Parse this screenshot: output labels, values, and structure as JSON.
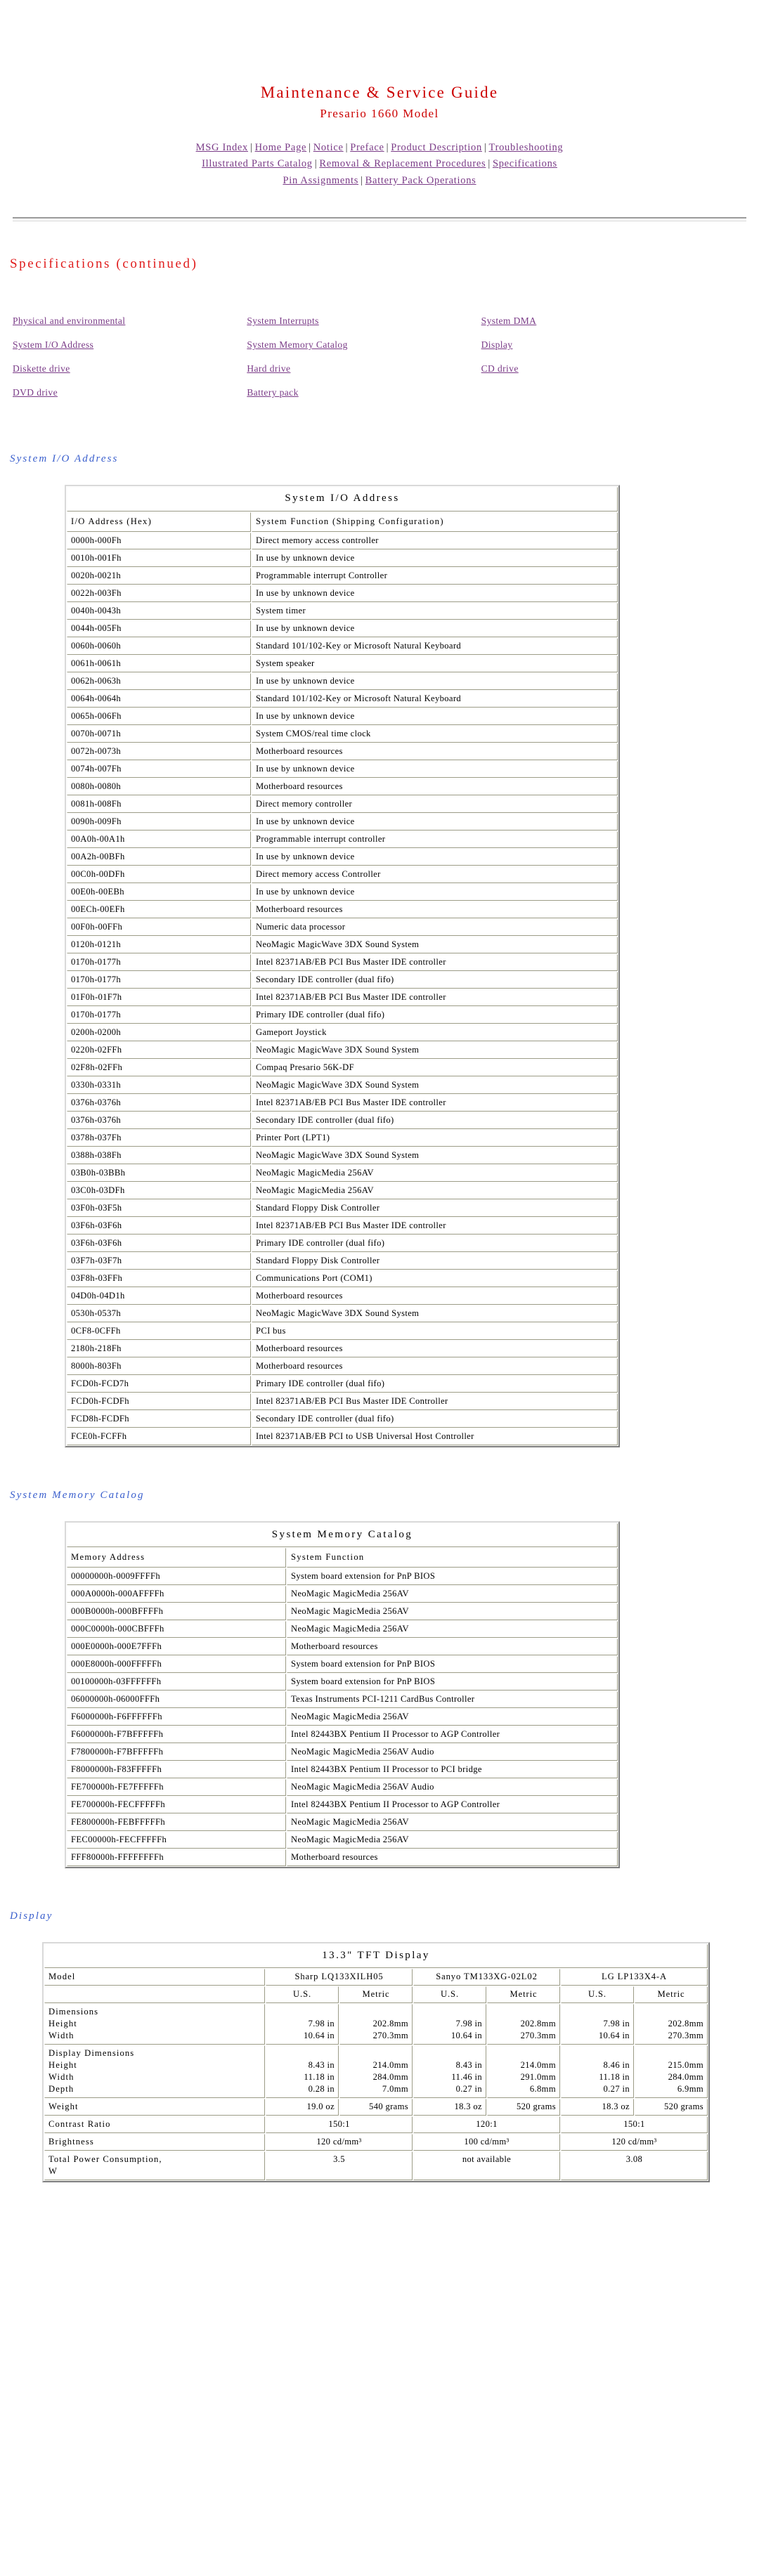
{
  "header": {
    "title": "Maintenance & Service Guide",
    "subtitle": "Presario 1660 Model",
    "nav_line1": [
      "MSG Index",
      "Home Page",
      "Notice",
      "Preface",
      "Product Description",
      "Troubleshooting"
    ],
    "nav_line2": [
      "Illustrated Parts Catalog",
      "Removal & Replacement Procedures",
      "Specifications"
    ],
    "nav_line3": [
      "Pin Assignments",
      "Battery Pack Operations"
    ],
    "separator": "|"
  },
  "page_heading": "Specifications (continued)",
  "link_grid": [
    [
      "Physical and environmental",
      "System Interrupts",
      "System DMA"
    ],
    [
      "System I/O Address",
      "System Memory Catalog",
      "Display"
    ],
    [
      "Diskette drive",
      "Hard drive",
      "CD drive"
    ],
    [
      "DVD drive",
      "Battery pack",
      ""
    ]
  ],
  "io_section": {
    "subhead": "System I/O Address",
    "caption": "System I/O Address",
    "columns": [
      "I/O Address (Hex)",
      "System Function (Shipping Configuration)"
    ],
    "rows": [
      [
        "0000h-000Fh",
        "Direct memory access controller"
      ],
      [
        "0010h-001Fh",
        "In use by unknown device"
      ],
      [
        "0020h-0021h",
        "Programmable interrupt Controller"
      ],
      [
        "0022h-003Fh",
        "In use by unknown device"
      ],
      [
        "0040h-0043h",
        "System timer"
      ],
      [
        "0044h-005Fh",
        "In use by unknown device"
      ],
      [
        "0060h-0060h",
        "Standard 101/102-Key or Microsoft Natural Keyboard"
      ],
      [
        "0061h-0061h",
        "System speaker"
      ],
      [
        "0062h-0063h",
        "In use by unknown device"
      ],
      [
        "0064h-0064h",
        "Standard 101/102-Key or Microsoft Natural Keyboard"
      ],
      [
        "0065h-006Fh",
        "In use by unknown device"
      ],
      [
        "0070h-0071h",
        "System CMOS/real time clock"
      ],
      [
        "0072h-0073h",
        "Motherboard resources"
      ],
      [
        "0074h-007Fh",
        "In use by unknown device"
      ],
      [
        "0080h-0080h",
        "Motherboard resources"
      ],
      [
        "0081h-008Fh",
        "Direct memory controller"
      ],
      [
        "0090h-009Fh",
        "In use by unknown device"
      ],
      [
        "00A0h-00A1h",
        "Programmable interrupt controller"
      ],
      [
        "00A2h-00BFh",
        "In use by unknown device"
      ],
      [
        "00C0h-00DFh",
        "Direct memory access Controller"
      ],
      [
        "00E0h-00EBh",
        "In use by unknown device"
      ],
      [
        "00ECh-00EFh",
        "Motherboard resources"
      ],
      [
        "00F0h-00FFh",
        "Numeric data processor"
      ],
      [
        "0120h-0121h",
        "NeoMagic MagicWave 3DX Sound System"
      ],
      [
        "0170h-0177h",
        "Intel 82371AB/EB PCI Bus Master IDE controller"
      ],
      [
        "0170h-0177h",
        "Secondary IDE controller (dual fifo)"
      ],
      [
        "01F0h-01F7h",
        "Intel 82371AB/EB PCI Bus Master IDE controller"
      ],
      [
        "0170h-0177h",
        "Primary IDE controller (dual fifo)"
      ],
      [
        "0200h-0200h",
        "Gameport Joystick"
      ],
      [
        "0220h-02FFh",
        "NeoMagic MagicWave 3DX Sound System"
      ],
      [
        "02F8h-02FFh",
        "Compaq Presario 56K-DF"
      ],
      [
        "0330h-0331h",
        "NeoMagic MagicWave 3DX Sound System"
      ],
      [
        "0376h-0376h",
        "Intel 82371AB/EB PCI Bus Master IDE controller"
      ],
      [
        "0376h-0376h",
        "Secondary IDE controller (dual fifo)"
      ],
      [
        "0378h-037Fh",
        "Printer Port (LPT1)"
      ],
      [
        "0388h-038Fh",
        "NeoMagic MagicWave 3DX Sound System"
      ],
      [
        "03B0h-03BBh",
        "NeoMagic MagicMedia 256AV"
      ],
      [
        "03C0h-03DFh",
        "NeoMagic MagicMedia 256AV"
      ],
      [
        "03F0h-03F5h",
        "Standard Floppy Disk Controller"
      ],
      [
        "03F6h-03F6h",
        "Intel 82371AB/EB PCI Bus Master IDE controller"
      ],
      [
        "03F6h-03F6h",
        "Primary IDE controller (dual fifo)"
      ],
      [
        "03F7h-03F7h",
        "Standard Floppy Disk Controller"
      ],
      [
        "03F8h-03FFh",
        "Communications Port (COM1)"
      ],
      [
        "04D0h-04D1h",
        "Motherboard resources"
      ],
      [
        "0530h-0537h",
        "NeoMagic MagicWave 3DX Sound System"
      ],
      [
        "0CF8-0CFFh",
        "PCI bus"
      ],
      [
        "2180h-218Fh",
        "Motherboard resources"
      ],
      [
        "8000h-803Fh",
        "Motherboard resources"
      ],
      [
        "FCD0h-FCD7h",
        "Primary IDE controller (dual fifo)"
      ],
      [
        "FCD0h-FCDFh",
        "Intel 82371AB/EB PCI Bus Master IDE Controller"
      ],
      [
        "FCD8h-FCDFh",
        "Secondary IDE controller (dual fifo)"
      ],
      [
        "FCE0h-FCFFh",
        "Intel 82371AB/EB PCI to USB Universal Host Controller"
      ]
    ]
  },
  "memory_section": {
    "subhead": "System Memory Catalog",
    "caption": "System Memory Catalog",
    "columns": [
      "Memory Address",
      "System Function"
    ],
    "rows": [
      [
        "00000000h-0009FFFFh",
        "System board extension for PnP BIOS"
      ],
      [
        "000A0000h-000AFFFFh",
        "NeoMagic MagicMedia 256AV"
      ],
      [
        "000B0000h-000BFFFFh",
        "NeoMagic MagicMedia 256AV"
      ],
      [
        "000C0000h-000CBFFFh",
        "NeoMagic MagicMedia 256AV"
      ],
      [
        "000E0000h-000E7FFFh",
        "Motherboard resources"
      ],
      [
        "000E8000h-000FFFFFh",
        "System board extension for PnP BIOS"
      ],
      [
        "00100000h-03FFFFFFh",
        "System board extension for PnP BIOS"
      ],
      [
        "06000000h-06000FFFh",
        "Texas Instruments PCI-1211 CardBus Controller"
      ],
      [
        "F6000000h-F6FFFFFFh",
        "NeoMagic MagicMedia 256AV"
      ],
      [
        "F6000000h-F7BFFFFFh",
        "Intel 82443BX Pentium II Processor to AGP Controller"
      ],
      [
        "F7800000h-F7BFFFFFh",
        "NeoMagic MagicMedia 256AV Audio"
      ],
      [
        "F8000000h-F83FFFFFh",
        "Intel 82443BX Pentium II Processor to PCI bridge"
      ],
      [
        "FE700000h-FE7FFFFFh",
        "NeoMagic MagicMedia 256AV Audio"
      ],
      [
        "FE700000h-FECFFFFFh",
        "Intel 82443BX Pentium II Processor to AGP Controller"
      ],
      [
        "FE800000h-FEBFFFFFh",
        "NeoMagic MagicMedia 256AV"
      ],
      [
        "FEC00000h-FECFFFFFh",
        "NeoMagic MagicMedia 256AV"
      ],
      [
        "FFF80000h-FFFFFFFFh",
        "Motherboard resources"
      ]
    ]
  },
  "display_section": {
    "subhead": "Display",
    "caption": "13.3\" TFT Display",
    "model_label": "Model",
    "models": [
      "Sharp LQ133XILH05",
      "Sanyo TM133XG-02L02",
      "LG LP133X4-A"
    ],
    "unit_headers": [
      "U.S.",
      "Metric",
      "U.S.",
      "Metric",
      "U.S.",
      "Metric"
    ],
    "rows": [
      {
        "label_lines": [
          "Dimensions",
          "Height",
          "Width"
        ],
        "type": "units",
        "cells": [
          [
            "",
            "7.98 in",
            "10.64 in"
          ],
          [
            "",
            "202.8mm",
            "270.3mm"
          ],
          [
            "",
            "7.98 in",
            "10.64 in"
          ],
          [
            "",
            "202.8mm",
            "270.3mm"
          ],
          [
            "",
            "7.98 in",
            "10.64 in"
          ],
          [
            "",
            "202.8mm",
            "270.3mm"
          ]
        ]
      },
      {
        "label_lines": [
          "Display Dimensions",
          "Height",
          "Width",
          "Depth"
        ],
        "type": "units",
        "cells": [
          [
            "",
            "8.43 in",
            "11.18 in",
            "0.28 in"
          ],
          [
            "",
            "214.0mm",
            "284.0mm",
            "7.0mm"
          ],
          [
            "",
            "8.43 in",
            "11.46 in",
            "0.27 in"
          ],
          [
            "",
            "214.0mm",
            "291.0mm",
            "6.8mm"
          ],
          [
            "",
            "8.46 in",
            "11.18 in",
            "0.27 in"
          ],
          [
            "",
            "215.0mm",
            "284.0mm",
            "6.9mm"
          ]
        ]
      },
      {
        "label_lines": [
          "Weight"
        ],
        "type": "units",
        "cells": [
          [
            "19.0 oz"
          ],
          [
            "540 grams"
          ],
          [
            "18.3 oz"
          ],
          [
            "520 grams"
          ],
          [
            "18.3 oz"
          ],
          [
            "520 grams"
          ]
        ]
      },
      {
        "label_lines": [
          "Contrast Ratio"
        ],
        "type": "merged",
        "cells": [
          "150:1",
          "120:1",
          "150:1"
        ]
      },
      {
        "label_lines": [
          "Brightness"
        ],
        "type": "merged",
        "cells": [
          "120 cd/mm³",
          "100 cd/mm³",
          "120 cd/mm³"
        ]
      },
      {
        "label_lines": [
          "Total Power Consumption,",
          "W"
        ],
        "type": "merged",
        "cells": [
          "3.5",
          "not available",
          "3.08"
        ]
      }
    ]
  },
  "colors": {
    "title_red": "#cc0000",
    "heading_red": "#e01b1b",
    "link_purple": "#7a3b87",
    "subhead_blue": "#3a5fcd"
  }
}
